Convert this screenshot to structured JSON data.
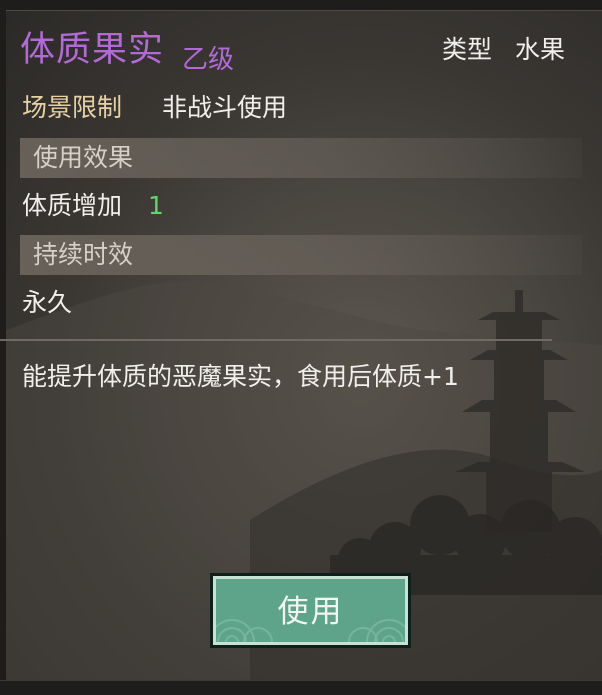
{
  "item": {
    "name": "体质果实",
    "grade": "乙级",
    "type_label": "类型",
    "type_value": "水果",
    "scene_label": "场景限制",
    "scene_value": "非战斗使用"
  },
  "effect_section": {
    "header": "使用效果",
    "stat": "体质增加",
    "amount": "1"
  },
  "duration_section": {
    "header": "持续时效",
    "value": "永久"
  },
  "description": "能提升体质的恶魔果实，食用后体质+1",
  "use_button": {
    "label": "使用"
  },
  "colors": {
    "title_purple": "#b16ad6",
    "scene_label_gold": "#e8d2a3",
    "amount_green": "#5ed66a",
    "button_green": "#5ea48a"
  }
}
